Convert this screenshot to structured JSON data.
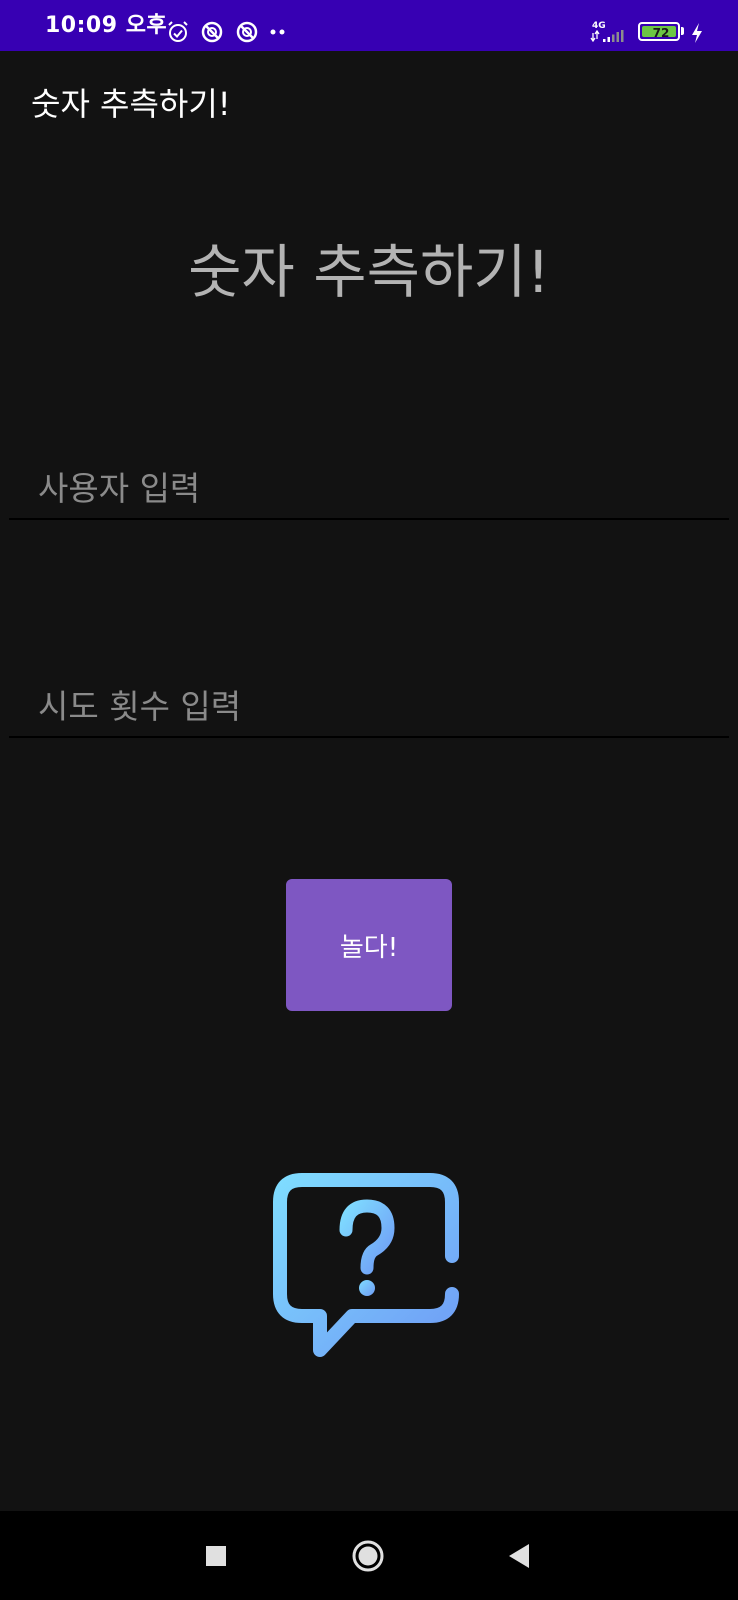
{
  "status_bar": {
    "time": "10:09 오후",
    "network": "4G",
    "battery": "72",
    "icons": [
      "alarm-icon",
      "sync-disabled-icon",
      "sync-disabled-icon",
      "more-notifications-icon",
      "signal-icon",
      "battery-icon",
      "charging-icon"
    ]
  },
  "app_bar": {
    "title": "숫자 추측하기!"
  },
  "main": {
    "heading": "숫자 추측하기!",
    "user_input": {
      "placeholder": "사용자 입력",
      "value": ""
    },
    "tries_input": {
      "placeholder": "시도 횟수 입력",
      "value": ""
    },
    "play_button_label": "놀다!",
    "image_icon": "question-chat-bubble-icon"
  },
  "nav_bar": {
    "items": [
      "recents-button",
      "home-button",
      "back-button"
    ]
  },
  "colors": {
    "status_bar_bg": "#3700b3",
    "background": "#121212",
    "button_bg": "#7e57c2",
    "battery_fill": "#6cc644",
    "icon_gradient_start": "#7fdcff",
    "icon_gradient_end": "#6f9cf5"
  }
}
